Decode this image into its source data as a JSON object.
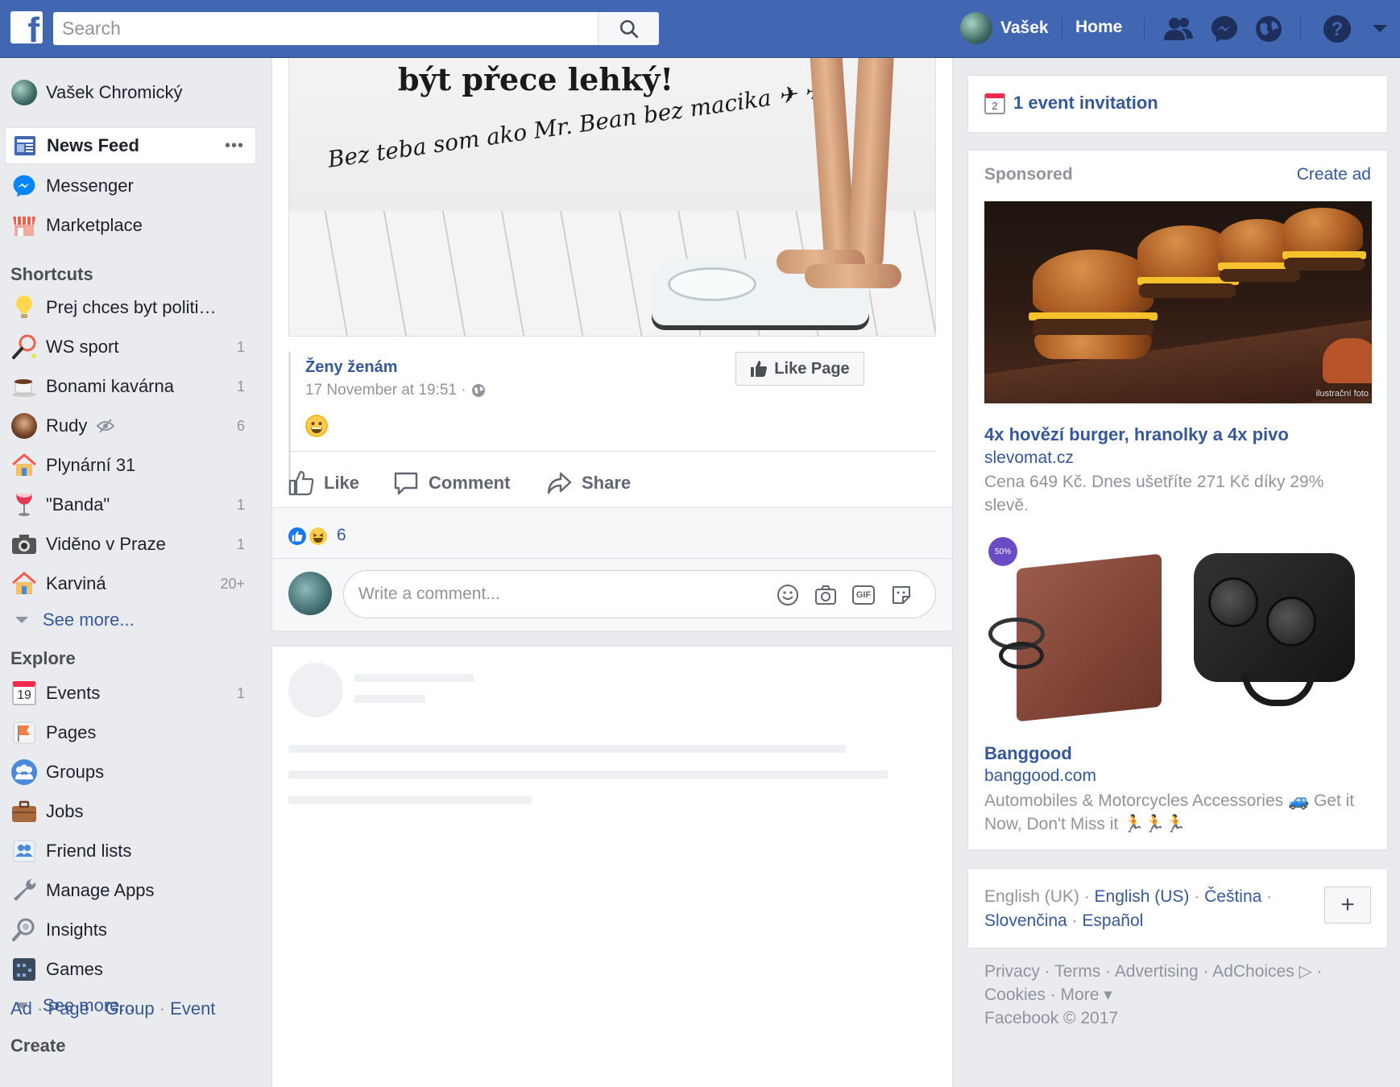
{
  "topbar": {
    "search_placeholder": "Search",
    "user_name": "Vašek",
    "home": "Home"
  },
  "leftnav": {
    "profile_name": "Vašek Chromický",
    "main_items": [
      {
        "label": "News Feed",
        "icon": "news-feed-icon",
        "more": "•••"
      },
      {
        "label": "Messenger",
        "icon": "messenger-icon"
      },
      {
        "label": "Marketplace",
        "icon": "marketplace-icon"
      }
    ],
    "shortcuts_title": "Shortcuts",
    "shortcuts": [
      {
        "label": "Prej chces byt politi…",
        "count": "",
        "icon": "lightbulb-icon"
      },
      {
        "label": "WS sport",
        "count": "1",
        "icon": "racket-icon"
      },
      {
        "label": "Bonami kavárna",
        "count": "1",
        "icon": "coffee-icon"
      },
      {
        "label": "Rudy",
        "count": "6",
        "icon": "avatar-icon"
      },
      {
        "label": "Plynární 31",
        "count": "",
        "icon": "house-icon"
      },
      {
        "label": "\"Banda\"",
        "count": "1",
        "icon": "wine-icon"
      },
      {
        "label": "Viděno v Praze",
        "count": "1",
        "icon": "camera-icon"
      },
      {
        "label": "Karviná",
        "count": "20+",
        "icon": "house-icon"
      }
    ],
    "see_more_1": "See more...",
    "explore_title": "Explore",
    "explore": [
      {
        "label": "Events",
        "count": "1",
        "icon": "calendar-icon",
        "icon_text": "19"
      },
      {
        "label": "Pages",
        "count": "",
        "icon": "flag-icon"
      },
      {
        "label": "Groups",
        "count": "",
        "icon": "groups-icon"
      },
      {
        "label": "Jobs",
        "count": "",
        "icon": "briefcase-icon"
      },
      {
        "label": "Friend lists",
        "count": "",
        "icon": "friend-list-icon"
      },
      {
        "label": "Manage Apps",
        "count": "",
        "icon": "wrench-icon"
      },
      {
        "label": "Insights",
        "count": "",
        "icon": "insights-icon"
      },
      {
        "label": "Games",
        "count": "",
        "icon": "games-icon"
      }
    ],
    "see_more_2": "See more...",
    "create_title": "Create",
    "create_links": {
      "ad": "Ad",
      "page": "Page",
      "group": "Group",
      "event": "Event",
      "sep": " · "
    }
  },
  "post": {
    "image_caption_1": "být přece lehký!",
    "image_caption_2": "Bez teba som ako Mr. Bean bez macika ✈ ✈",
    "page_name": "Ženy ženám",
    "timestamp": "17 November at 19:51 ·",
    "like_page": "Like Page",
    "actions": {
      "like": "Like",
      "comment": "Comment",
      "share": "Share"
    },
    "reaction_count": "6",
    "comment_placeholder": "Write a comment...",
    "gif_label": "GIF"
  },
  "right": {
    "event_invitation": "1 event invitation",
    "event_icon_text": "2",
    "sponsored_title": "Sponsored",
    "create_ad": "Create ad",
    "ad1": {
      "image_note": "ilustrační foto",
      "headline": "4x hovězí burger, hranolky a 4x pivo",
      "domain": "slevomat.cz",
      "description": "Cena 649 Kč. Dnes ušetříte 271 Kč díky 29% slevě."
    },
    "ad2": {
      "badge": "50%",
      "headline": "Banggood",
      "domain": "banggood.com",
      "description": "Automobiles & Motorcycles Accessories 🚙 Get it Now, Don't Miss it 🏃🏃🏃"
    },
    "languages": {
      "current": "English (UK)",
      "links": [
        "English (US)",
        "Čeština",
        "Slovenčina",
        "Español"
      ],
      "sep": " · "
    },
    "footer": {
      "line1": "Privacy · Terms · Advertising · AdChoices ▷ ·",
      "line2": "Cookies · More ▾",
      "line3": "Facebook © 2017"
    }
  },
  "colors": {
    "brand": "#4267b2",
    "link": "#365899",
    "muted": "#90949c"
  }
}
